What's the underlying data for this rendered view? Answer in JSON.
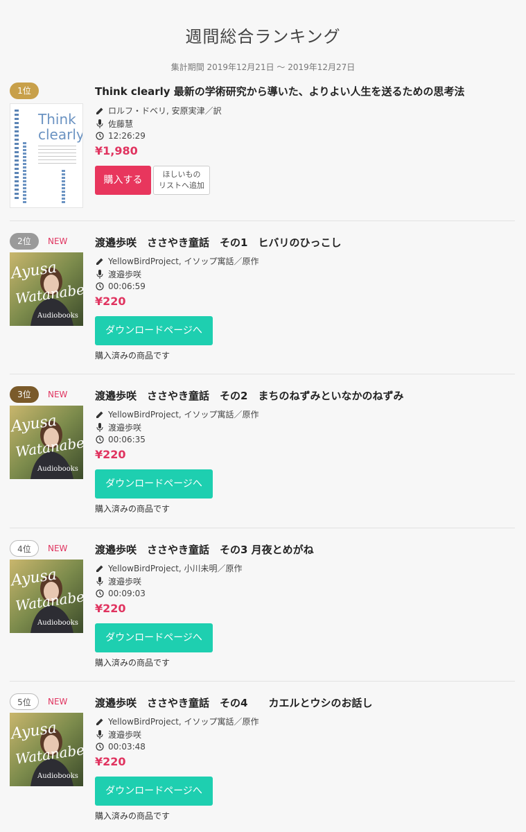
{
  "header": {
    "title": "週間総合ランキング",
    "period": "集計期間 2019年12月21日 〜 2019年12月27日"
  },
  "items": [
    {
      "rank": "1位",
      "new": "",
      "title": "Think clearly 最新の学術研究から導いた、よりよい人生を送るための思考法",
      "author": "ロルフ・ドベリ, 安原実津／訳",
      "narrator": "佐藤慧",
      "duration": "12:26:29",
      "price": "¥1,980",
      "buy_label": "購入する",
      "wish_line1": "ほしいもの",
      "wish_line2": "リストへ追加",
      "cover_title_1": "Think",
      "cover_title_2": "clearly"
    },
    {
      "rank": "2位",
      "new": "NEW",
      "title": "渡邉歩咲　ささやき童話　その1　ヒバリのひっこし",
      "author": "YellowBirdProject, イソップ寓話／原作",
      "narrator": "渡邉歩咲",
      "duration": "00:06:59",
      "price": "¥220",
      "download_label": "ダウンロードページへ",
      "purchased": "購入済みの商品です"
    },
    {
      "rank": "3位",
      "new": "NEW",
      "title": "渡邉歩咲　ささやき童話　その2　まちのねずみといなかのねずみ",
      "author": "YellowBirdProject, イソップ寓話／原作",
      "narrator": "渡邉歩咲",
      "duration": "00:06:35",
      "price": "¥220",
      "download_label": "ダウンロードページへ",
      "purchased": "購入済みの商品です"
    },
    {
      "rank": "4位",
      "new": "NEW",
      "title": "渡邉歩咲　ささやき童話　その3 月夜とめがね",
      "author": "YellowBirdProject, 小川未明／原作",
      "narrator": "渡邉歩咲",
      "duration": "00:09:03",
      "price": "¥220",
      "download_label": "ダウンロードページへ",
      "purchased": "購入済みの商品です"
    },
    {
      "rank": "5位",
      "new": "NEW",
      "title": "渡邉歩咲　ささやき童話　その4　　カエルとウシのお話し",
      "author": "YellowBirdProject, イソップ寓話／原作",
      "narrator": "渡邉歩咲",
      "duration": "00:03:48",
      "price": "¥220",
      "download_label": "ダウンロードページへ",
      "purchased": "購入済みの商品です"
    }
  ],
  "cover_art": {
    "script_line1": "Ayusa",
    "script_line2": "Watanabe",
    "subtitle": "Audiobooks"
  },
  "colors": {
    "price": "#e0335f",
    "buy_button": "#e8365d",
    "download_button": "#1ecfb0",
    "rank_gold": "#c8a04a",
    "rank_silver": "#9a9a9a",
    "rank_bronze": "#7a5a2a"
  },
  "icons": {
    "author": "pencil-icon",
    "narrator": "microphone-icon",
    "duration": "clock-icon"
  }
}
